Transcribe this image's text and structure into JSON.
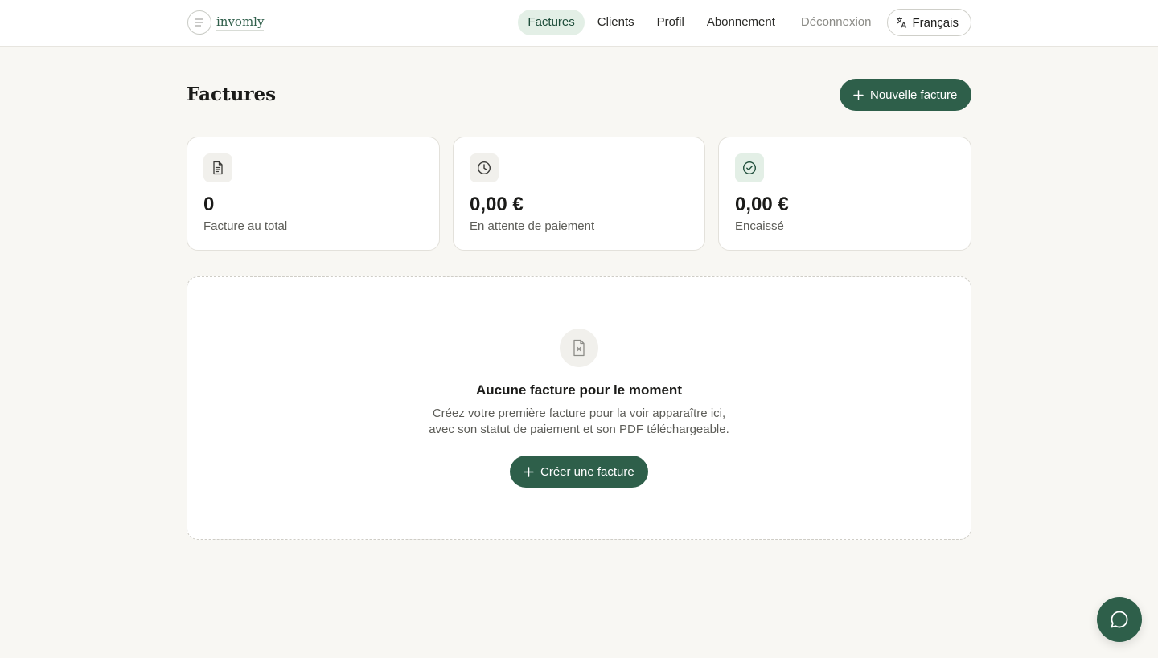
{
  "brand": {
    "name": "invomly",
    "logo_icon": "menu-lines-icon"
  },
  "nav": {
    "items": [
      {
        "label": "Factures",
        "active": true
      },
      {
        "label": "Clients"
      },
      {
        "label": "Profil"
      },
      {
        "label": "Abonnement"
      }
    ],
    "logout_label": "Déconnexion",
    "language": {
      "label": "Français",
      "icon": "translate-icon"
    }
  },
  "page": {
    "title": "Factures",
    "new_button_label": "Nouvelle facture",
    "new_button_icon": "plus-icon"
  },
  "stats": [
    {
      "value": "0",
      "label": "Facture au total",
      "icon": "document-icon"
    },
    {
      "value": "0,00 €",
      "label": "En attente de paiement",
      "icon": "clock-icon"
    },
    {
      "value": "0,00 €",
      "label": "Encaissé",
      "icon": "check-circle-icon"
    }
  ],
  "empty_state": {
    "icon": "file-x-icon",
    "title": "Aucune facture pour le moment",
    "description_line1": "Créez votre première facture pour la voir apparaître ici,",
    "description_line2": "avec son statut de paiement et son PDF téléchargeable.",
    "button_label": "Créer une facture"
  },
  "chat": {
    "icon": "chat-bubble-icon"
  },
  "colors": {
    "accent": "#2e5f4a",
    "accent_soft": "#e3efe6",
    "background": "#f8f7f3"
  }
}
